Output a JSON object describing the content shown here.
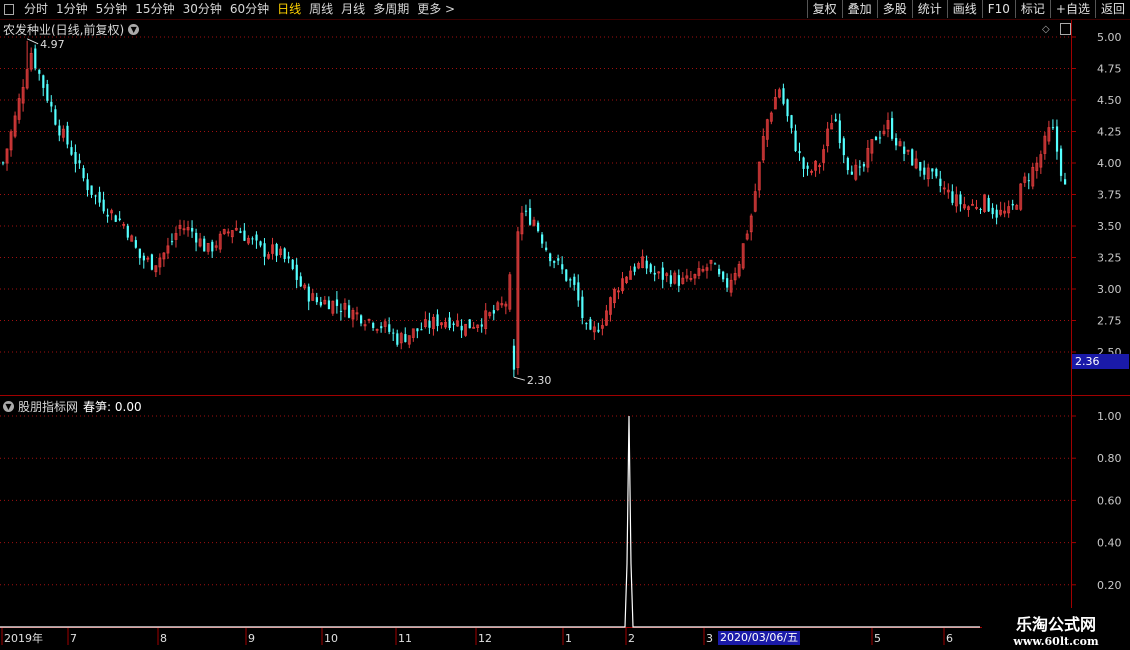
{
  "toolbar": {
    "periods": [
      "分时",
      "1分钟",
      "5分钟",
      "15分钟",
      "30分钟",
      "60分钟",
      "日线",
      "周线",
      "月线",
      "多周期",
      "更多 >"
    ],
    "active_period": "日线",
    "right_buttons": [
      "复权",
      "叠加",
      "多股",
      "统计",
      "画线",
      "F10",
      "标记",
      "+自选",
      "返回"
    ]
  },
  "main_pane": {
    "title": "农发种业(日线,前复权)",
    "high_label": "4.97",
    "low_label": "2.30",
    "current_price": "2.36"
  },
  "indicator_pane": {
    "title": "股朋指标网",
    "indicator_label": "春笋: 0.00"
  },
  "date_axis": {
    "labels": [
      "2019年",
      "7",
      "8",
      "9",
      "10",
      "11",
      "12",
      "1",
      "2",
      "3",
      "5",
      "6"
    ],
    "cursor_date": "2020/03/06/五"
  },
  "watermark": {
    "line1": "乐淘公式网",
    "line2": "www.60lt.com"
  },
  "colors": {
    "up": "#e03c3c",
    "down": "#54ffff",
    "grid": "#a01010",
    "axis": "#a00000",
    "spike": "#ffffff"
  },
  "chart_data": [
    {
      "type": "candlestick",
      "title": "农发种业(日线,前复权)",
      "y_ticks": [
        5.0,
        4.75,
        4.5,
        4.25,
        4.0,
        3.75,
        3.5,
        3.25,
        3.0,
        2.75,
        2.5
      ],
      "ylim": [
        2.3,
        5.05
      ],
      "max": 4.97,
      "min": 2.3,
      "approx_close_path": [
        4.0,
        4.4,
        4.9,
        4.6,
        4.3,
        4.1,
        3.85,
        3.7,
        3.6,
        3.5,
        3.25,
        3.2,
        3.3,
        3.5,
        3.45,
        3.3,
        3.4,
        3.5,
        3.4,
        3.3,
        3.3,
        3.2,
        3.0,
        2.9,
        2.9,
        2.85,
        2.8,
        2.75,
        2.7,
        2.6,
        2.65,
        2.7,
        2.75,
        2.75,
        2.7,
        2.75,
        2.8,
        2.9,
        3.6,
        3.55,
        3.3,
        3.15,
        3.0,
        2.6,
        2.75,
        3.0,
        3.15,
        3.2,
        3.1,
        3.1,
        3.05,
        3.1,
        3.2,
        3.0,
        3.2,
        3.6,
        4.3,
        4.6,
        4.2,
        3.9,
        4.0,
        4.4,
        4.0,
        3.9,
        4.2,
        4.3,
        4.1,
        4.0,
        3.9,
        3.8,
        3.7,
        3.65,
        3.7,
        3.6,
        3.6,
        3.85,
        4.0,
        4.3,
        3.8
      ]
    },
    {
      "type": "line",
      "title": "春笋",
      "y_ticks": [
        1.0,
        0.8,
        0.6,
        0.4,
        0.2
      ],
      "ylim": [
        0,
        1.05
      ],
      "series": [
        {
          "name": "春笋",
          "description": "zero everywhere except a single spike",
          "values": [
            0,
            1.0,
            0
          ],
          "spike_date_region": "2"
        }
      ]
    }
  ]
}
